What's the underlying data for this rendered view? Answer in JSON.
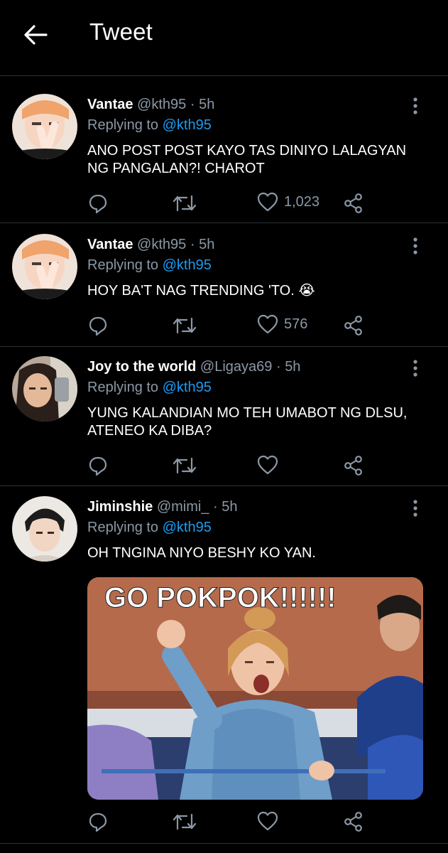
{
  "header": {
    "title": "Tweet"
  },
  "tweets": [
    {
      "name": "Vantae",
      "handle": "@kth95",
      "dot": "·",
      "time": "5h",
      "replying_prefix": "Replying to",
      "replying_to": "@kth95",
      "text_lines": [
        "ANO POST POST KAYO TAS DINIYO LALAGYAN",
        "NG PANGALAN?! CHAROT"
      ],
      "like_count": "1,023"
    },
    {
      "name": "Vantae",
      "handle": "@kth95",
      "dot": "·",
      "time": "5h",
      "replying_prefix": "Replying to",
      "replying_to": "@kth95",
      "text_lines": [
        "HOY BA'T NAG TRENDING 'TO. 😭"
      ],
      "like_count": "576"
    },
    {
      "name": "Joy to the world",
      "handle": "@Ligaya69",
      "dot": "·",
      "time": "5h",
      "replying_prefix": "Replying to",
      "replying_to": "@kth95",
      "text_lines": [
        "YUNG KALANDIAN MO TEH UMABOT NG DLSU,",
        "ATENEO KA DIBA?"
      ],
      "like_count": ""
    },
    {
      "name": "Jiminshie",
      "handle": "@mimi_",
      "dot": "·",
      "time": "5h",
      "replying_prefix": "Replying to",
      "replying_to": "@kth95",
      "text_lines": [
        "OH TNGINA NIYO BESHY KO YAN."
      ],
      "like_count": "",
      "media_caption": "GO POKPOK!!!!!!"
    }
  ],
  "icons": {
    "back": "arrow-left-icon",
    "more": "more-vertical-icon",
    "reply": "reply-icon",
    "retweet": "retweet-icon",
    "like": "heart-icon",
    "share": "share-icon"
  },
  "colors": {
    "background": "#000000",
    "secondary_text": "#8b98a5",
    "link": "#1d9bf0",
    "divider": "#2f3336"
  }
}
